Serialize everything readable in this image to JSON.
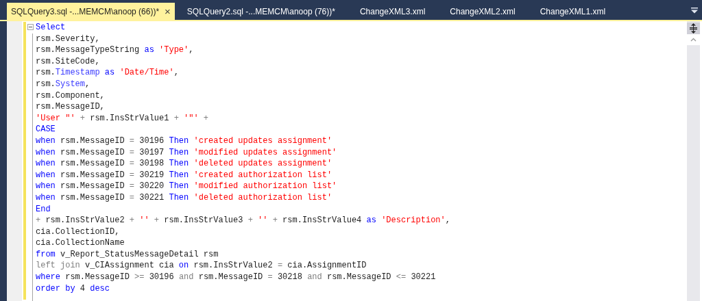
{
  "tabs": [
    {
      "label": "SQLQuery3.sql -...MEMCM\\anoop (66))*",
      "selected": true,
      "close": "×"
    },
    {
      "label": "SQLQuery2.sql -...MEMCM\\anoop (76))*",
      "selected": false
    },
    {
      "label": "ChangeXML3.xml",
      "selected": false
    },
    {
      "label": "ChangeXML2.xml",
      "selected": false
    },
    {
      "label": "ChangeXML1.xml",
      "selected": false
    }
  ],
  "editor": {
    "lines": [
      {
        "foldable": true,
        "tokens": [
          {
            "kind": "kw",
            "text": "Select"
          }
        ]
      },
      {
        "foldable": false,
        "tokens": [
          {
            "kind": "p",
            "text": "rsm.Severity,"
          }
        ]
      },
      {
        "foldable": false,
        "tokens": [
          {
            "kind": "p",
            "text": "rsm.MessageTypeString "
          },
          {
            "kind": "kw",
            "text": "as "
          },
          {
            "kind": "s",
            "text": "'Type'"
          },
          {
            "kind": "p",
            "text": ","
          }
        ]
      },
      {
        "foldable": false,
        "tokens": [
          {
            "kind": "p",
            "text": "rsm.SiteCode,"
          }
        ]
      },
      {
        "foldable": false,
        "tokens": [
          {
            "kind": "p",
            "text": "rsm."
          },
          {
            "kind": "f",
            "text": "Timestamp "
          },
          {
            "kind": "kw",
            "text": "as "
          },
          {
            "kind": "s",
            "text": "'Date/Time'"
          },
          {
            "kind": "p",
            "text": ","
          }
        ]
      },
      {
        "foldable": false,
        "tokens": [
          {
            "kind": "p",
            "text": "rsm."
          },
          {
            "kind": "f",
            "text": "System"
          },
          {
            "kind": "p",
            "text": ","
          }
        ]
      },
      {
        "foldable": false,
        "tokens": [
          {
            "kind": "p",
            "text": "rsm.Component,"
          }
        ]
      },
      {
        "foldable": false,
        "tokens": [
          {
            "kind": "p",
            "text": "rsm.MessageID,"
          }
        ]
      },
      {
        "foldable": false,
        "tokens": [
          {
            "kind": "s",
            "text": "'User \"' "
          },
          {
            "kind": "o",
            "text": "+"
          },
          {
            "kind": "p",
            "text": " rsm.InsStrValue1 "
          },
          {
            "kind": "o",
            "text": "+ "
          },
          {
            "kind": "s",
            "text": "'\"' "
          },
          {
            "kind": "o",
            "text": "+"
          }
        ]
      },
      {
        "foldable": false,
        "tokens": [
          {
            "kind": "kw",
            "text": "CASE"
          }
        ]
      },
      {
        "foldable": false,
        "tokens": [
          {
            "kind": "kw",
            "text": "when"
          },
          {
            "kind": "p",
            "text": " rsm.MessageID "
          },
          {
            "kind": "o",
            "text": "="
          },
          {
            "kind": "p",
            "text": " 30196 "
          },
          {
            "kind": "kw",
            "text": "Then "
          },
          {
            "kind": "s",
            "text": "'created updates assignment'"
          }
        ]
      },
      {
        "foldable": false,
        "tokens": [
          {
            "kind": "kw",
            "text": "when"
          },
          {
            "kind": "p",
            "text": " rsm.MessageID "
          },
          {
            "kind": "o",
            "text": "="
          },
          {
            "kind": "p",
            "text": " 30197 "
          },
          {
            "kind": "kw",
            "text": "Then "
          },
          {
            "kind": "s",
            "text": "'modified updates assignment'"
          }
        ]
      },
      {
        "foldable": false,
        "tokens": [
          {
            "kind": "kw",
            "text": "when"
          },
          {
            "kind": "p",
            "text": " rsm.MessageID "
          },
          {
            "kind": "o",
            "text": "="
          },
          {
            "kind": "p",
            "text": " 30198 "
          },
          {
            "kind": "kw",
            "text": "Then "
          },
          {
            "kind": "s",
            "text": "'deleted updates assignment'"
          }
        ]
      },
      {
        "foldable": false,
        "tokens": [
          {
            "kind": "kw",
            "text": "when"
          },
          {
            "kind": "p",
            "text": " rsm.MessageID "
          },
          {
            "kind": "o",
            "text": "="
          },
          {
            "kind": "p",
            "text": " 30219 "
          },
          {
            "kind": "kw",
            "text": "Then "
          },
          {
            "kind": "s",
            "text": "'created authorization list'"
          }
        ]
      },
      {
        "foldable": false,
        "tokens": [
          {
            "kind": "kw",
            "text": "when"
          },
          {
            "kind": "p",
            "text": " rsm.MessageID "
          },
          {
            "kind": "o",
            "text": "="
          },
          {
            "kind": "p",
            "text": " 30220 "
          },
          {
            "kind": "kw",
            "text": "Then "
          },
          {
            "kind": "s",
            "text": "'modified authorization list'"
          }
        ]
      },
      {
        "foldable": false,
        "tokens": [
          {
            "kind": "kw",
            "text": "when"
          },
          {
            "kind": "p",
            "text": " rsm.MessageID "
          },
          {
            "kind": "o",
            "text": "="
          },
          {
            "kind": "p",
            "text": " 30221 "
          },
          {
            "kind": "kw",
            "text": "Then "
          },
          {
            "kind": "s",
            "text": "'deleted authorization list'"
          }
        ]
      },
      {
        "foldable": false,
        "tokens": [
          {
            "kind": "kw",
            "text": "End"
          }
        ]
      },
      {
        "foldable": false,
        "tokens": [
          {
            "kind": "o",
            "text": "+"
          },
          {
            "kind": "p",
            "text": " rsm.InsStrValue2 "
          },
          {
            "kind": "o",
            "text": "+ "
          },
          {
            "kind": "s",
            "text": "'' "
          },
          {
            "kind": "o",
            "text": "+"
          },
          {
            "kind": "p",
            "text": " rsm.InsStrValue3 "
          },
          {
            "kind": "o",
            "text": "+ "
          },
          {
            "kind": "s",
            "text": "'' "
          },
          {
            "kind": "o",
            "text": "+"
          },
          {
            "kind": "p",
            "text": " rsm.InsStrValue4 "
          },
          {
            "kind": "kw",
            "text": "as "
          },
          {
            "kind": "s",
            "text": "'Description'"
          },
          {
            "kind": "p",
            "text": ","
          }
        ]
      },
      {
        "foldable": false,
        "tokens": [
          {
            "kind": "p",
            "text": "cia.CollectionID,"
          }
        ]
      },
      {
        "foldable": false,
        "tokens": [
          {
            "kind": "p",
            "text": "cia.CollectionName"
          }
        ]
      },
      {
        "foldable": false,
        "tokens": [
          {
            "kind": "kw",
            "text": "from"
          },
          {
            "kind": "p",
            "text": " v_Report_StatusMessageDetail rsm"
          }
        ]
      },
      {
        "foldable": false,
        "tokens": [
          {
            "kind": "o",
            "text": "left join"
          },
          {
            "kind": "p",
            "text": " v_CIAssignment cia "
          },
          {
            "kind": "kw",
            "text": "on"
          },
          {
            "kind": "p",
            "text": " rsm.InsStrValue2 "
          },
          {
            "kind": "o",
            "text": "="
          },
          {
            "kind": "p",
            "text": " cia.AssignmentID"
          }
        ]
      },
      {
        "foldable": false,
        "tokens": [
          {
            "kind": "kw",
            "text": "where"
          },
          {
            "kind": "p",
            "text": " rsm.MessageID "
          },
          {
            "kind": "o",
            "text": ">="
          },
          {
            "kind": "p",
            "text": " 30196 "
          },
          {
            "kind": "o",
            "text": "and"
          },
          {
            "kind": "p",
            "text": " rsm.MessageID "
          },
          {
            "kind": "o",
            "text": "="
          },
          {
            "kind": "p",
            "text": " 30218 "
          },
          {
            "kind": "o",
            "text": "and"
          },
          {
            "kind": "p",
            "text": " rsm.MessageID "
          },
          {
            "kind": "o",
            "text": "<="
          },
          {
            "kind": "p",
            "text": " 30221"
          }
        ]
      },
      {
        "foldable": false,
        "tokens": [
          {
            "kind": "kw",
            "text": "order by"
          },
          {
            "kind": "p",
            "text": " 4 "
          },
          {
            "kind": "kw",
            "text": "desc"
          }
        ]
      }
    ]
  }
}
